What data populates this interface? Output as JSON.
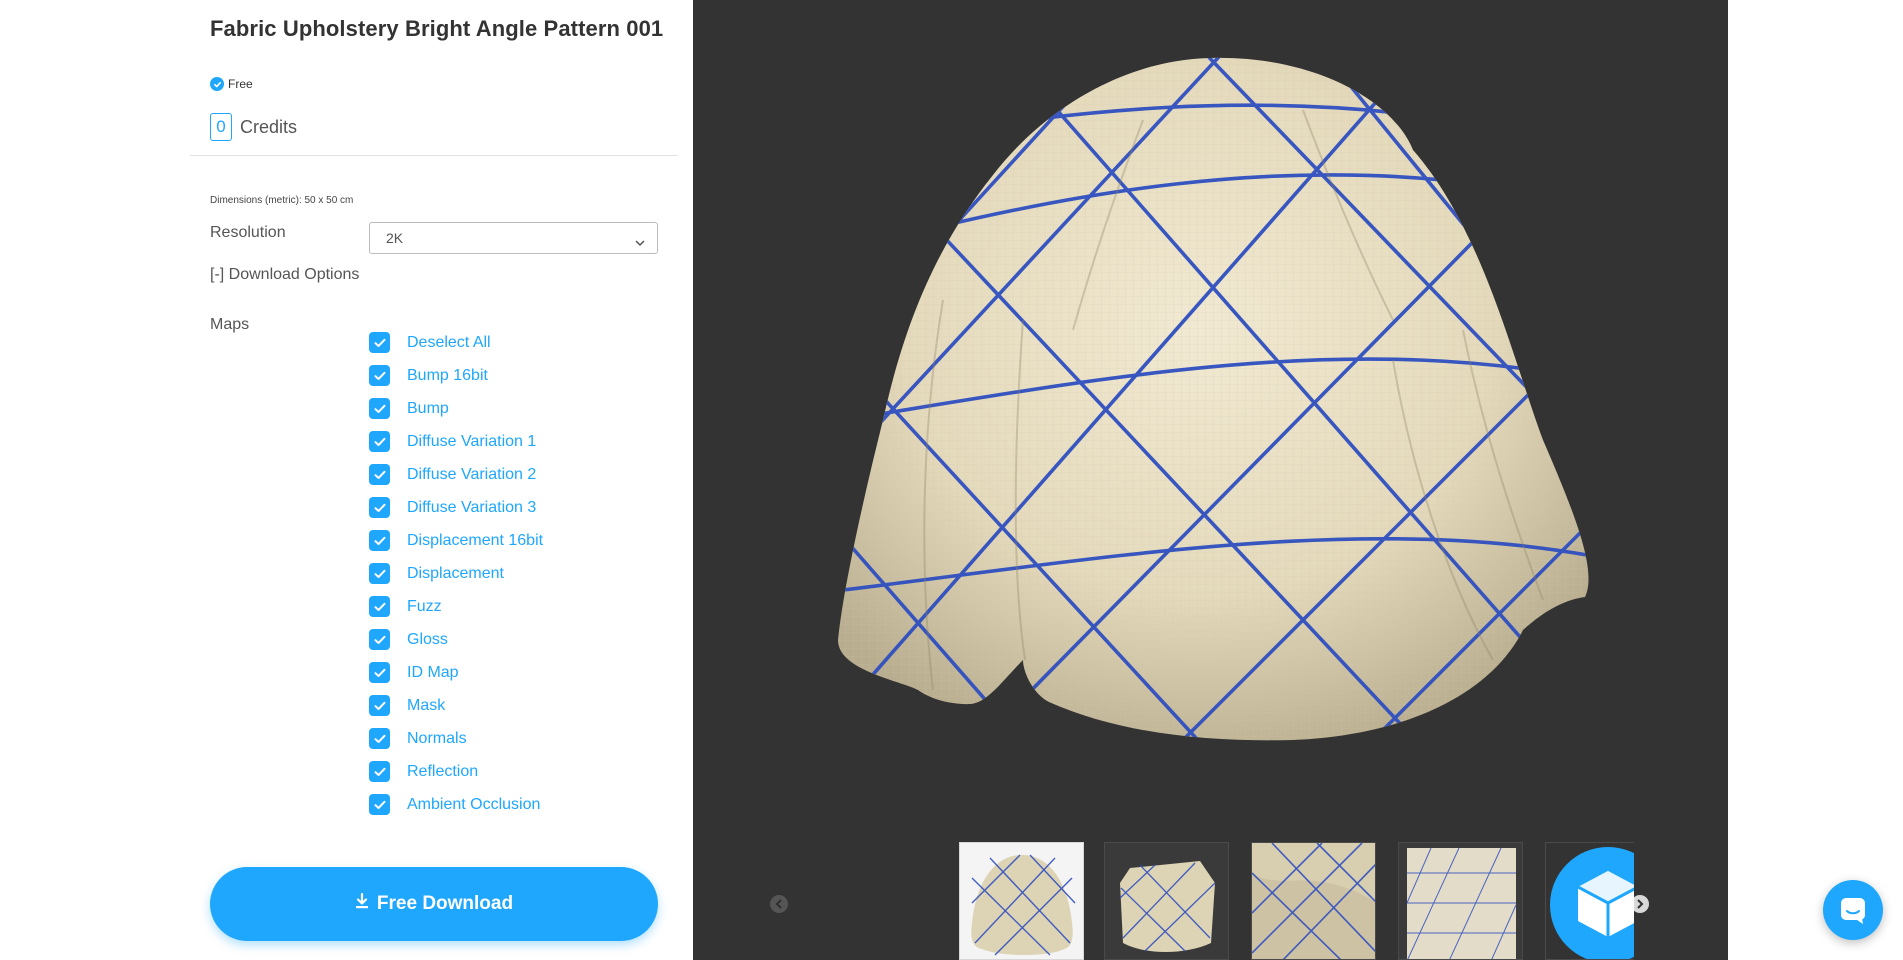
{
  "product": {
    "title": "Fabric Upholstery Bright Angle Pattern 001",
    "price_label": "Free",
    "credits_value": "0",
    "credits_label": "Credits"
  },
  "options": {
    "dimensions": "Dimensions (metric): 50 x 50 cm",
    "resolution_label": "Resolution",
    "resolution_value": "2K",
    "download_options_label": "[-] Download Options",
    "maps_label": "Maps"
  },
  "maps": [
    {
      "label": "Deselect All",
      "checked": true
    },
    {
      "label": "Bump 16bit",
      "checked": true
    },
    {
      "label": "Bump",
      "checked": true
    },
    {
      "label": "Diffuse Variation 1",
      "checked": true
    },
    {
      "label": "Diffuse Variation 2",
      "checked": true
    },
    {
      "label": "Diffuse Variation 3",
      "checked": true
    },
    {
      "label": "Displacement 16bit",
      "checked": true
    },
    {
      "label": "Displacement",
      "checked": true
    },
    {
      "label": "Fuzz",
      "checked": true
    },
    {
      "label": "Gloss",
      "checked": true
    },
    {
      "label": "ID Map",
      "checked": true
    },
    {
      "label": "Mask",
      "checked": true
    },
    {
      "label": "Normals",
      "checked": true
    },
    {
      "label": "Reflection",
      "checked": true
    },
    {
      "label": "Ambient Occlusion",
      "checked": true
    }
  ],
  "download_button": {
    "label": "Free Download",
    "icon": "download-icon"
  },
  "viewer": {
    "thumbnails": [
      {
        "name": "draped-sphere-thumbnail",
        "active": true
      },
      {
        "name": "draped-cube-thumbnail",
        "active": false
      },
      {
        "name": "fabric-closeup-thumbnail",
        "active": false
      },
      {
        "name": "flat-swatch-thumbnail",
        "active": false
      },
      {
        "name": "3d-viewer-thumbnail",
        "active": false
      }
    ],
    "prev_icon": "chevron-left-icon",
    "next_icon": "chevron-right-icon"
  },
  "chat": {
    "icon": "chat-icon"
  },
  "colors": {
    "accent": "#1ea7fd",
    "viewer_bg": "#333333",
    "fabric": "#e9dfc2",
    "pattern_lines": "#2f4fc0"
  }
}
